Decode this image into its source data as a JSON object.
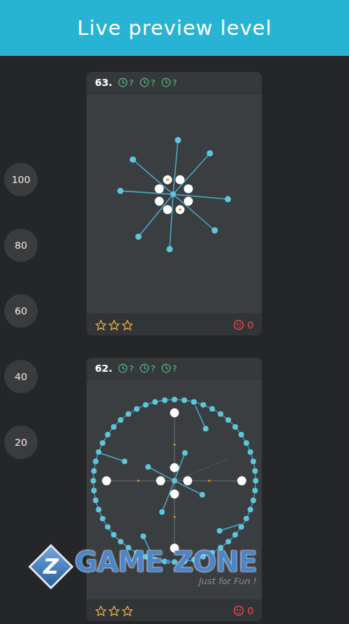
{
  "header": {
    "title": "Live preview level"
  },
  "scale": [
    {
      "label": "100"
    },
    {
      "label": "80"
    },
    {
      "label": "60"
    },
    {
      "label": "40"
    },
    {
      "label": "20"
    }
  ],
  "levels": [
    {
      "number": "63.",
      "timers": [
        "?",
        "?",
        "?"
      ],
      "stars": 0,
      "deaths": "0",
      "kind": "star",
      "pieces": [
        {
          "marked": true
        },
        {
          "marked": false
        },
        {
          "marked": false
        },
        {
          "marked": false
        },
        {
          "marked": false
        },
        {
          "marked": false
        },
        {
          "marked": false
        },
        {
          "marked": true
        }
      ]
    },
    {
      "number": "62.",
      "timers": [
        "?",
        "?",
        "?"
      ],
      "stars": 0,
      "deaths": "0",
      "kind": "ring",
      "pieces": [
        {
          "marked": false
        },
        {
          "marked": false
        },
        {
          "marked": false
        },
        {
          "marked": false
        },
        {
          "marked": false
        },
        {
          "marked": false
        },
        {
          "marked": false
        },
        {
          "marked": false
        }
      ]
    }
  ],
  "watermark": {
    "logo_letter": "Z",
    "words": [
      "GAME",
      "ZONE"
    ],
    "tagline": "Just for Fun !"
  }
}
